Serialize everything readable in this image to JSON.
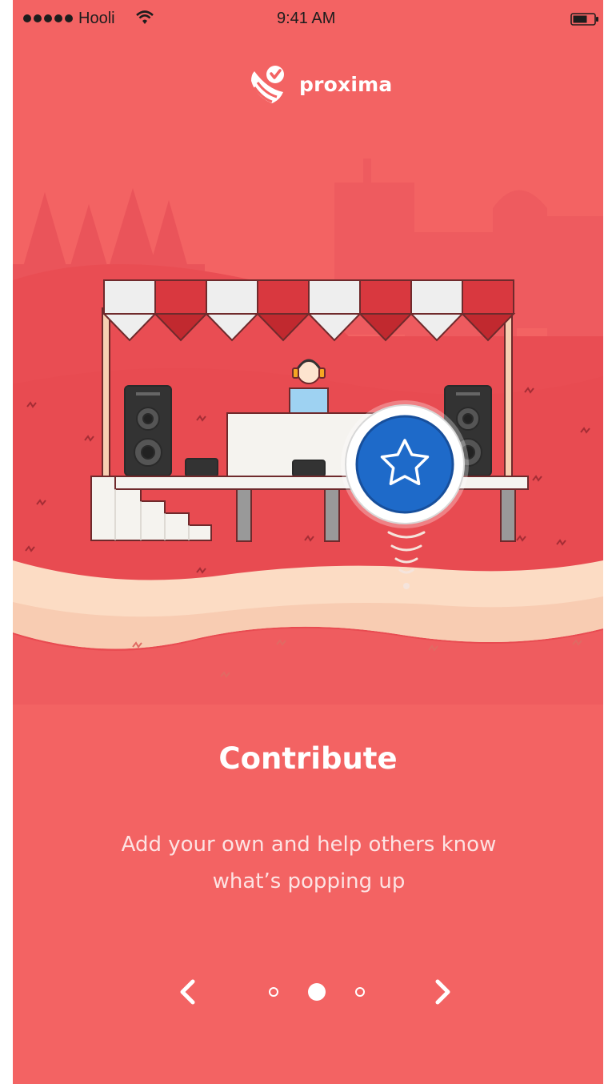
{
  "status_bar": {
    "carrier": "Hooli",
    "time": "9:41 AM",
    "signal_dots": 5
  },
  "app": {
    "name": "proxima"
  },
  "onboarding": {
    "title": "Contribute",
    "description_line1": "Add your own and help others know",
    "description_line2": "what’s popping up",
    "page_indicator": {
      "total": 3,
      "current": 2
    }
  },
  "navigation": {
    "prev_icon": "chevron-left-icon",
    "next_icon": "chevron-right-icon"
  },
  "colors": {
    "background": "#f36363",
    "hill": "#e84b51",
    "skyline": "#ec5a5e",
    "path": "#fcdcc4",
    "marker": "#1e6ac9"
  }
}
